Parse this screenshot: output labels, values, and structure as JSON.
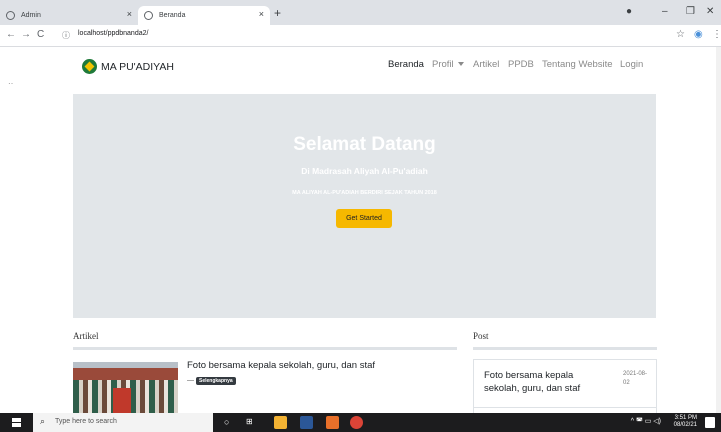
{
  "browser": {
    "tabs": [
      {
        "title": "Admin"
      },
      {
        "title": "Beranda"
      }
    ],
    "new_tab": "+",
    "tab_close": "×",
    "url": "localhost/ppdbnanda2/",
    "window": {
      "minimize": "–",
      "restore": "❐",
      "close": "✕"
    }
  },
  "site": {
    "brand": "MA PU'ADIYAH",
    "nav": [
      {
        "label": "Beranda",
        "active": true
      },
      {
        "label": "Profil",
        "dropdown": true
      },
      {
        "label": "Artikel"
      },
      {
        "label": "PPDB"
      },
      {
        "label": "Tentang Website"
      },
      {
        "label": "Login"
      }
    ],
    "hero": {
      "title": "Selamat Datang",
      "subtitle": "Di Madrasah Aliyah Al-Pu'adiah",
      "since": "MA ALIYAH AL-PU'ADIAH BERDIRI SEJAK TAHUN 2018",
      "cta": "Get Started"
    },
    "artikel": {
      "heading": "Artikel",
      "items": [
        {
          "title": "Foto bersama kepala sekolah, guru, dan staf",
          "dash": "—",
          "more": "Selengkapnya"
        }
      ]
    },
    "post": {
      "heading": "Post",
      "items": [
        {
          "title": "Foto bersama kepala sekolah, guru, dan staf",
          "date": "2021-08-02"
        }
      ]
    }
  },
  "taskbar": {
    "search_placeholder": "Type here to search",
    "time": "3:51 PM",
    "date": "08/02/21"
  },
  "colors": {
    "hero_bg": "#e2e6e9",
    "cta": "#f6b800",
    "logo_green": "#1f7a3a"
  }
}
